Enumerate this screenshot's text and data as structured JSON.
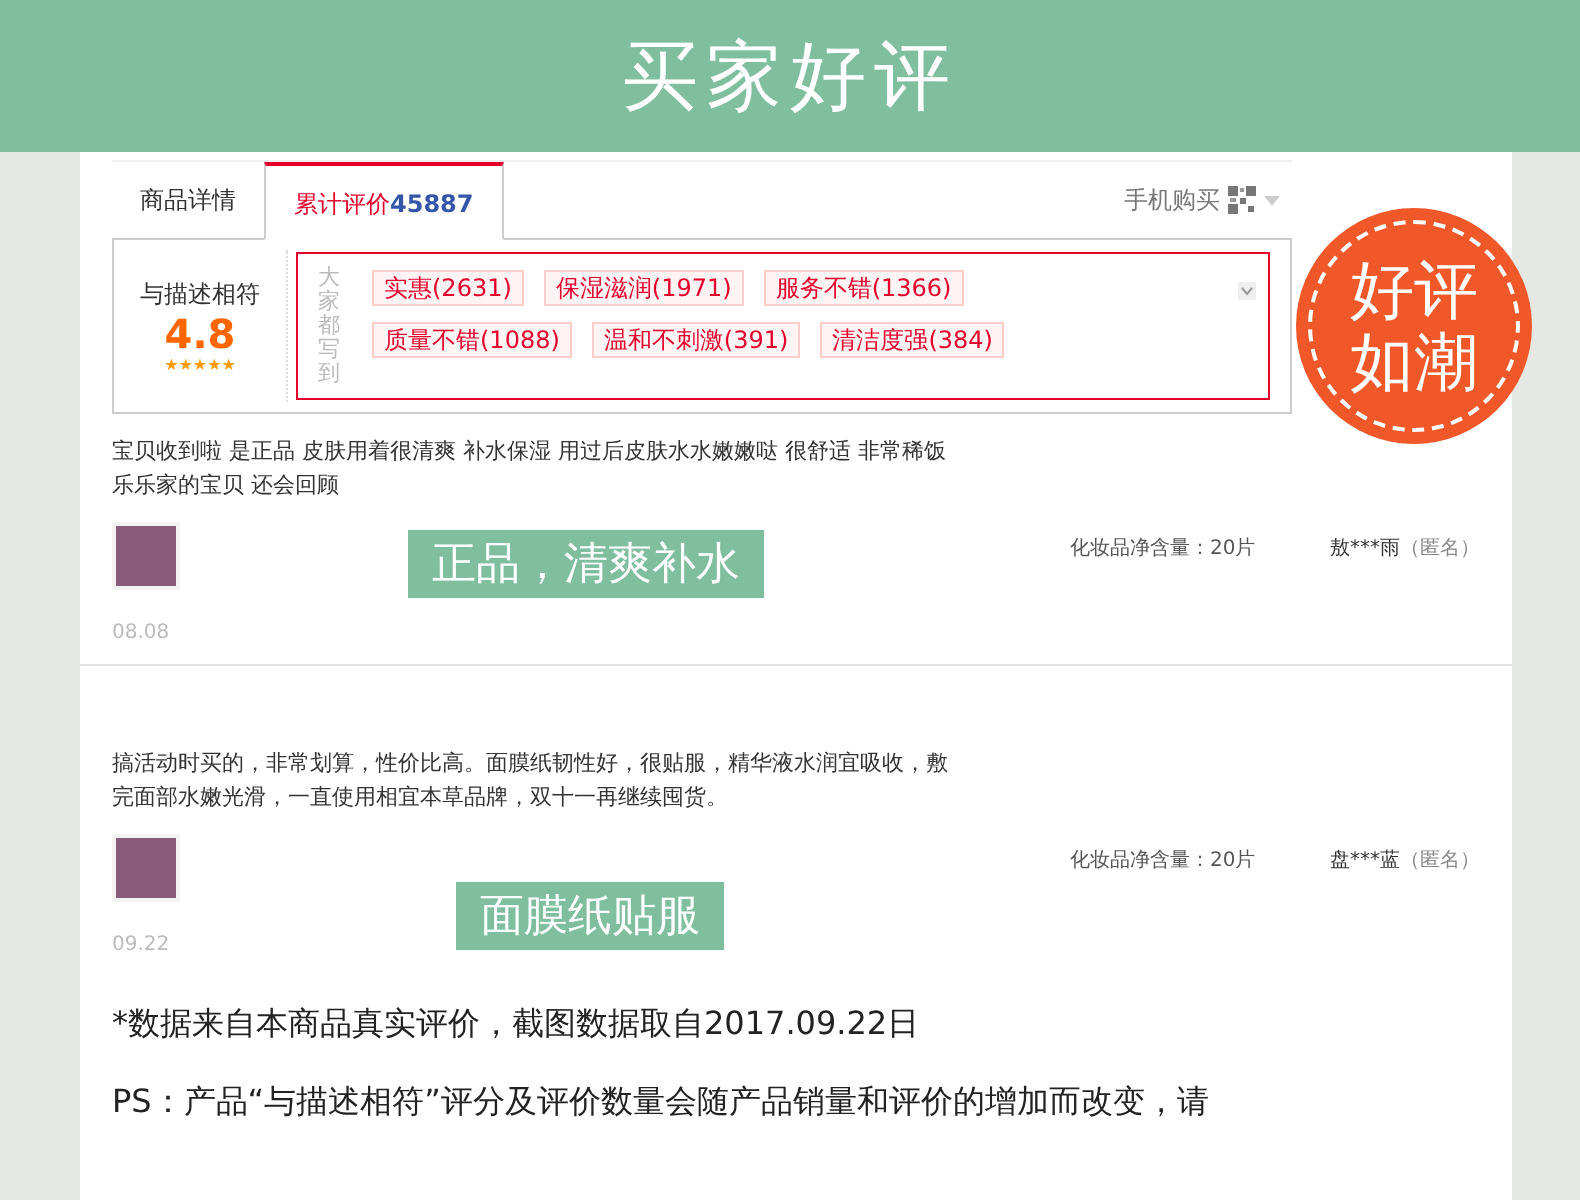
{
  "banner": {
    "title": "买家好评"
  },
  "tabs": [
    {
      "label": "商品详情",
      "selected": false
    },
    {
      "label": "累计评价",
      "count": "45887",
      "selected": true
    }
  ],
  "mobile_buy": "手机购买",
  "rating": {
    "label": "与描述相符",
    "score": "4.8",
    "stars": 5
  },
  "tags_heading": "大家都写到",
  "tags": [
    {
      "label": "实惠(2631)"
    },
    {
      "label": "保湿滋润(1971)"
    },
    {
      "label": "服务不错(1366)"
    },
    {
      "label": "质量不错(1088)"
    },
    {
      "label": "温和不刺激(391)"
    },
    {
      "label": "清洁度强(384)"
    }
  ],
  "badge": {
    "line1": "好评",
    "line2": "如潮"
  },
  "reviews": [
    {
      "text": "宝贝收到啦 是正品 皮肤用着很清爽 补水保湿 用过后皮肤水水嫩嫩哒 很舒适 非常稀饭乐乐家的宝贝 还会回顾",
      "highlight_caption": "正品，清爽补水",
      "spec": "化妆品净含量：20片",
      "user": "敖***雨",
      "anon": "（匿名）",
      "date": "08.08"
    },
    {
      "text": "搞活动时买的，非常划算，性价比高。面膜纸韧性好，很贴服，精华液水润宜吸收，敷完面部水嫩光滑，一直使用相宜本草品牌，双十一再继续囤货。",
      "highlight_caption": "面膜纸贴服",
      "spec": "化妆品净含量：20片",
      "user": "盘***蓝",
      "anon": "（匿名）",
      "date": "09.22"
    }
  ],
  "footnote": "*数据来自本商品真实评价，截图数据取自2017.09.22日",
  "ps": "PS：产品“与描述相符”评分及评价数量会随产品销量和评价的增加而改变，请"
}
